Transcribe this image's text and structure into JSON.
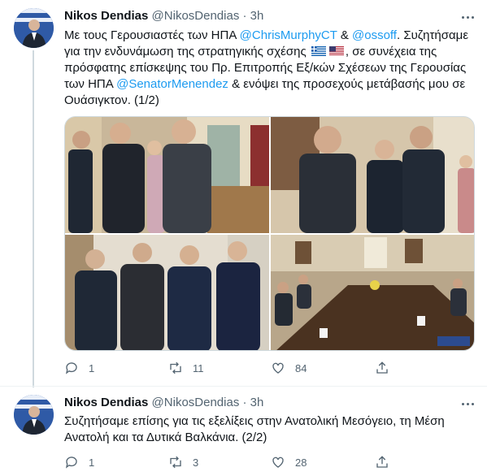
{
  "tweets": [
    {
      "author": {
        "name": "Nikos Dendias",
        "handle": "@NikosDendias",
        "dot": "·",
        "time": "3h"
      },
      "text": {
        "p1": "Με τους Γερουσιαστές των ΗΠΑ ",
        "m1": "@ChrisMurphyCT",
        "p2": " & ",
        "m2": "@ossoff",
        "p3": ". Συζητήσαμε για την ενδυνάμωση της στρατηγικής σχέσης ",
        "p4": ", σε συνέχεια της πρόσφατης επίσκεψης του Πρ. Επιτροπής Εξ/κών Σχέσεων της Γερουσίας των ΗΠΑ ",
        "m3": "@SenatorMenendez",
        "p5": " & ενόψει της προσεχούς μετάβασής μου σε Ουάσιγκτον. (1/2)"
      },
      "flags": [
        "greece-flag",
        "usa-flag"
      ],
      "stats": {
        "replies": "1",
        "retweets": "11",
        "likes": "84"
      }
    },
    {
      "author": {
        "name": "Nikos Dendias",
        "handle": "@NikosDendias",
        "dot": "·",
        "time": "3h"
      },
      "text": {
        "p1": "Συζητήσαμε επίσης για τις εξελίξεις στην Ανατολική Μεσόγειο, τη Μέση Ανατολή και τα Δυτικά Βαλκάνια. (2/2)"
      },
      "stats": {
        "replies": "1",
        "retweets": "3",
        "likes": "28"
      }
    }
  ],
  "icons": {
    "reply": "reply-icon",
    "retweet": "retweet-icon",
    "like": "heart-icon",
    "share": "share-icon",
    "more": "more-icon"
  },
  "colors": {
    "accent": "#1d9bf0",
    "muted": "#536471",
    "text": "#0f1419",
    "border": "#cfd9de"
  }
}
